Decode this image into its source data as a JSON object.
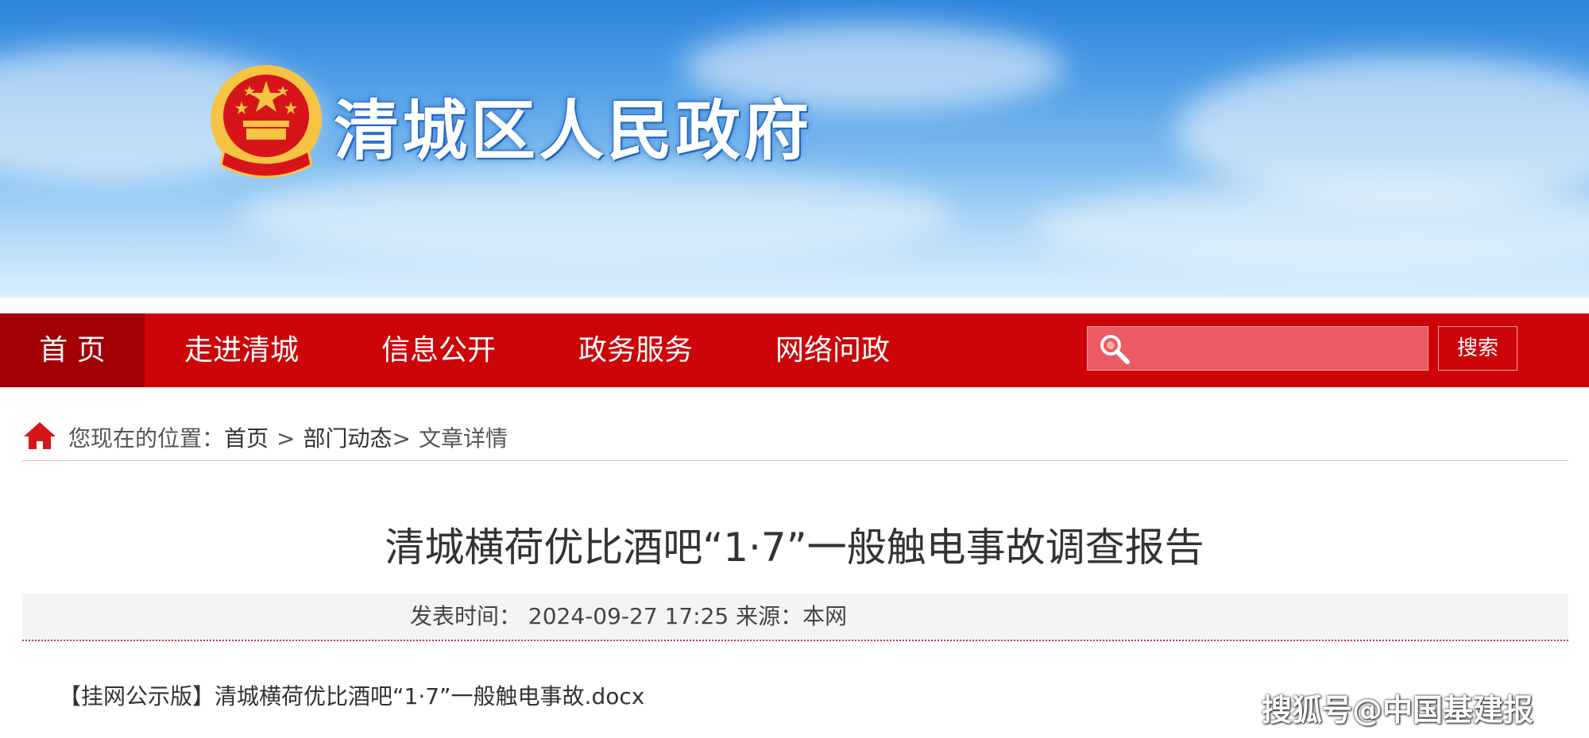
{
  "banner": {
    "site_title": "清城区人民政府",
    "emblem": "national-emblem",
    "colors": {
      "sky": "#4c9ce6",
      "emblem_red": "#d7141a",
      "emblem_gold": "#f6c443"
    }
  },
  "nav": {
    "items": [
      {
        "label": "首 页",
        "active": true
      },
      {
        "label": "走进清城",
        "active": false
      },
      {
        "label": "信息公开",
        "active": false
      },
      {
        "label": "政务服务",
        "active": false
      },
      {
        "label": "网络问政",
        "active": false
      }
    ],
    "search": {
      "value": "",
      "placeholder": "",
      "icon": "search-icon",
      "button_label": "搜索"
    },
    "colors": {
      "bar": "#cd0509",
      "active": "#a30006",
      "search_bg": "#ec5a63"
    }
  },
  "breadcrumb": {
    "icon": "home-icon",
    "prefix": "您现在的位置：",
    "items": [
      "首页",
      "部门动态",
      "文章详情"
    ],
    "separators": [
      ">",
      ">"
    ]
  },
  "article": {
    "title": "清城横荷优比酒吧“1·7”一般触电事故调查报告",
    "meta": {
      "published_label": "发表时间：",
      "published_value": "2024-09-27 17:25",
      "source_label": "来源：",
      "source_value": "本网"
    },
    "attachment": "【挂网公示版】清城横荷优比酒吧“1·7”一般触电事故.docx"
  },
  "watermark": "搜狐号@中国基建报"
}
